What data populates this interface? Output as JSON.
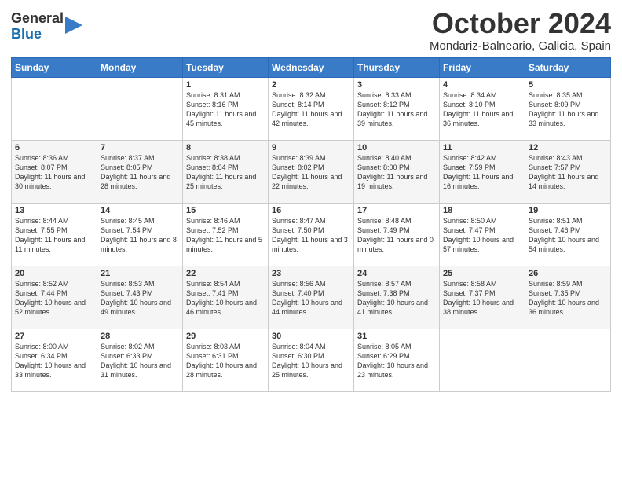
{
  "logo": {
    "line1": "General",
    "line2": "Blue"
  },
  "title": "October 2024",
  "location": "Mondariz-Balneario, Galicia, Spain",
  "days_of_week": [
    "Sunday",
    "Monday",
    "Tuesday",
    "Wednesday",
    "Thursday",
    "Friday",
    "Saturday"
  ],
  "weeks": [
    [
      {
        "day": "",
        "sunrise": "",
        "sunset": "",
        "daylight": ""
      },
      {
        "day": "",
        "sunrise": "",
        "sunset": "",
        "daylight": ""
      },
      {
        "day": "1",
        "sunrise": "Sunrise: 8:31 AM",
        "sunset": "Sunset: 8:16 PM",
        "daylight": "Daylight: 11 hours and 45 minutes."
      },
      {
        "day": "2",
        "sunrise": "Sunrise: 8:32 AM",
        "sunset": "Sunset: 8:14 PM",
        "daylight": "Daylight: 11 hours and 42 minutes."
      },
      {
        "day": "3",
        "sunrise": "Sunrise: 8:33 AM",
        "sunset": "Sunset: 8:12 PM",
        "daylight": "Daylight: 11 hours and 39 minutes."
      },
      {
        "day": "4",
        "sunrise": "Sunrise: 8:34 AM",
        "sunset": "Sunset: 8:10 PM",
        "daylight": "Daylight: 11 hours and 36 minutes."
      },
      {
        "day": "5",
        "sunrise": "Sunrise: 8:35 AM",
        "sunset": "Sunset: 8:09 PM",
        "daylight": "Daylight: 11 hours and 33 minutes."
      }
    ],
    [
      {
        "day": "6",
        "sunrise": "Sunrise: 8:36 AM",
        "sunset": "Sunset: 8:07 PM",
        "daylight": "Daylight: 11 hours and 30 minutes."
      },
      {
        "day": "7",
        "sunrise": "Sunrise: 8:37 AM",
        "sunset": "Sunset: 8:05 PM",
        "daylight": "Daylight: 11 hours and 28 minutes."
      },
      {
        "day": "8",
        "sunrise": "Sunrise: 8:38 AM",
        "sunset": "Sunset: 8:04 PM",
        "daylight": "Daylight: 11 hours and 25 minutes."
      },
      {
        "day": "9",
        "sunrise": "Sunrise: 8:39 AM",
        "sunset": "Sunset: 8:02 PM",
        "daylight": "Daylight: 11 hours and 22 minutes."
      },
      {
        "day": "10",
        "sunrise": "Sunrise: 8:40 AM",
        "sunset": "Sunset: 8:00 PM",
        "daylight": "Daylight: 11 hours and 19 minutes."
      },
      {
        "day": "11",
        "sunrise": "Sunrise: 8:42 AM",
        "sunset": "Sunset: 7:59 PM",
        "daylight": "Daylight: 11 hours and 16 minutes."
      },
      {
        "day": "12",
        "sunrise": "Sunrise: 8:43 AM",
        "sunset": "Sunset: 7:57 PM",
        "daylight": "Daylight: 11 hours and 14 minutes."
      }
    ],
    [
      {
        "day": "13",
        "sunrise": "Sunrise: 8:44 AM",
        "sunset": "Sunset: 7:55 PM",
        "daylight": "Daylight: 11 hours and 11 minutes."
      },
      {
        "day": "14",
        "sunrise": "Sunrise: 8:45 AM",
        "sunset": "Sunset: 7:54 PM",
        "daylight": "Daylight: 11 hours and 8 minutes."
      },
      {
        "day": "15",
        "sunrise": "Sunrise: 8:46 AM",
        "sunset": "Sunset: 7:52 PM",
        "daylight": "Daylight: 11 hours and 5 minutes."
      },
      {
        "day": "16",
        "sunrise": "Sunrise: 8:47 AM",
        "sunset": "Sunset: 7:50 PM",
        "daylight": "Daylight: 11 hours and 3 minutes."
      },
      {
        "day": "17",
        "sunrise": "Sunrise: 8:48 AM",
        "sunset": "Sunset: 7:49 PM",
        "daylight": "Daylight: 11 hours and 0 minutes."
      },
      {
        "day": "18",
        "sunrise": "Sunrise: 8:50 AM",
        "sunset": "Sunset: 7:47 PM",
        "daylight": "Daylight: 10 hours and 57 minutes."
      },
      {
        "day": "19",
        "sunrise": "Sunrise: 8:51 AM",
        "sunset": "Sunset: 7:46 PM",
        "daylight": "Daylight: 10 hours and 54 minutes."
      }
    ],
    [
      {
        "day": "20",
        "sunrise": "Sunrise: 8:52 AM",
        "sunset": "Sunset: 7:44 PM",
        "daylight": "Daylight: 10 hours and 52 minutes."
      },
      {
        "day": "21",
        "sunrise": "Sunrise: 8:53 AM",
        "sunset": "Sunset: 7:43 PM",
        "daylight": "Daylight: 10 hours and 49 minutes."
      },
      {
        "day": "22",
        "sunrise": "Sunrise: 8:54 AM",
        "sunset": "Sunset: 7:41 PM",
        "daylight": "Daylight: 10 hours and 46 minutes."
      },
      {
        "day": "23",
        "sunrise": "Sunrise: 8:56 AM",
        "sunset": "Sunset: 7:40 PM",
        "daylight": "Daylight: 10 hours and 44 minutes."
      },
      {
        "day": "24",
        "sunrise": "Sunrise: 8:57 AM",
        "sunset": "Sunset: 7:38 PM",
        "daylight": "Daylight: 10 hours and 41 minutes."
      },
      {
        "day": "25",
        "sunrise": "Sunrise: 8:58 AM",
        "sunset": "Sunset: 7:37 PM",
        "daylight": "Daylight: 10 hours and 38 minutes."
      },
      {
        "day": "26",
        "sunrise": "Sunrise: 8:59 AM",
        "sunset": "Sunset: 7:35 PM",
        "daylight": "Daylight: 10 hours and 36 minutes."
      }
    ],
    [
      {
        "day": "27",
        "sunrise": "Sunrise: 8:00 AM",
        "sunset": "Sunset: 6:34 PM",
        "daylight": "Daylight: 10 hours and 33 minutes."
      },
      {
        "day": "28",
        "sunrise": "Sunrise: 8:02 AM",
        "sunset": "Sunset: 6:33 PM",
        "daylight": "Daylight: 10 hours and 31 minutes."
      },
      {
        "day": "29",
        "sunrise": "Sunrise: 8:03 AM",
        "sunset": "Sunset: 6:31 PM",
        "daylight": "Daylight: 10 hours and 28 minutes."
      },
      {
        "day": "30",
        "sunrise": "Sunrise: 8:04 AM",
        "sunset": "Sunset: 6:30 PM",
        "daylight": "Daylight: 10 hours and 25 minutes."
      },
      {
        "day": "31",
        "sunrise": "Sunrise: 8:05 AM",
        "sunset": "Sunset: 6:29 PM",
        "daylight": "Daylight: 10 hours and 23 minutes."
      },
      {
        "day": "",
        "sunrise": "",
        "sunset": "",
        "daylight": ""
      },
      {
        "day": "",
        "sunrise": "",
        "sunset": "",
        "daylight": ""
      }
    ]
  ]
}
